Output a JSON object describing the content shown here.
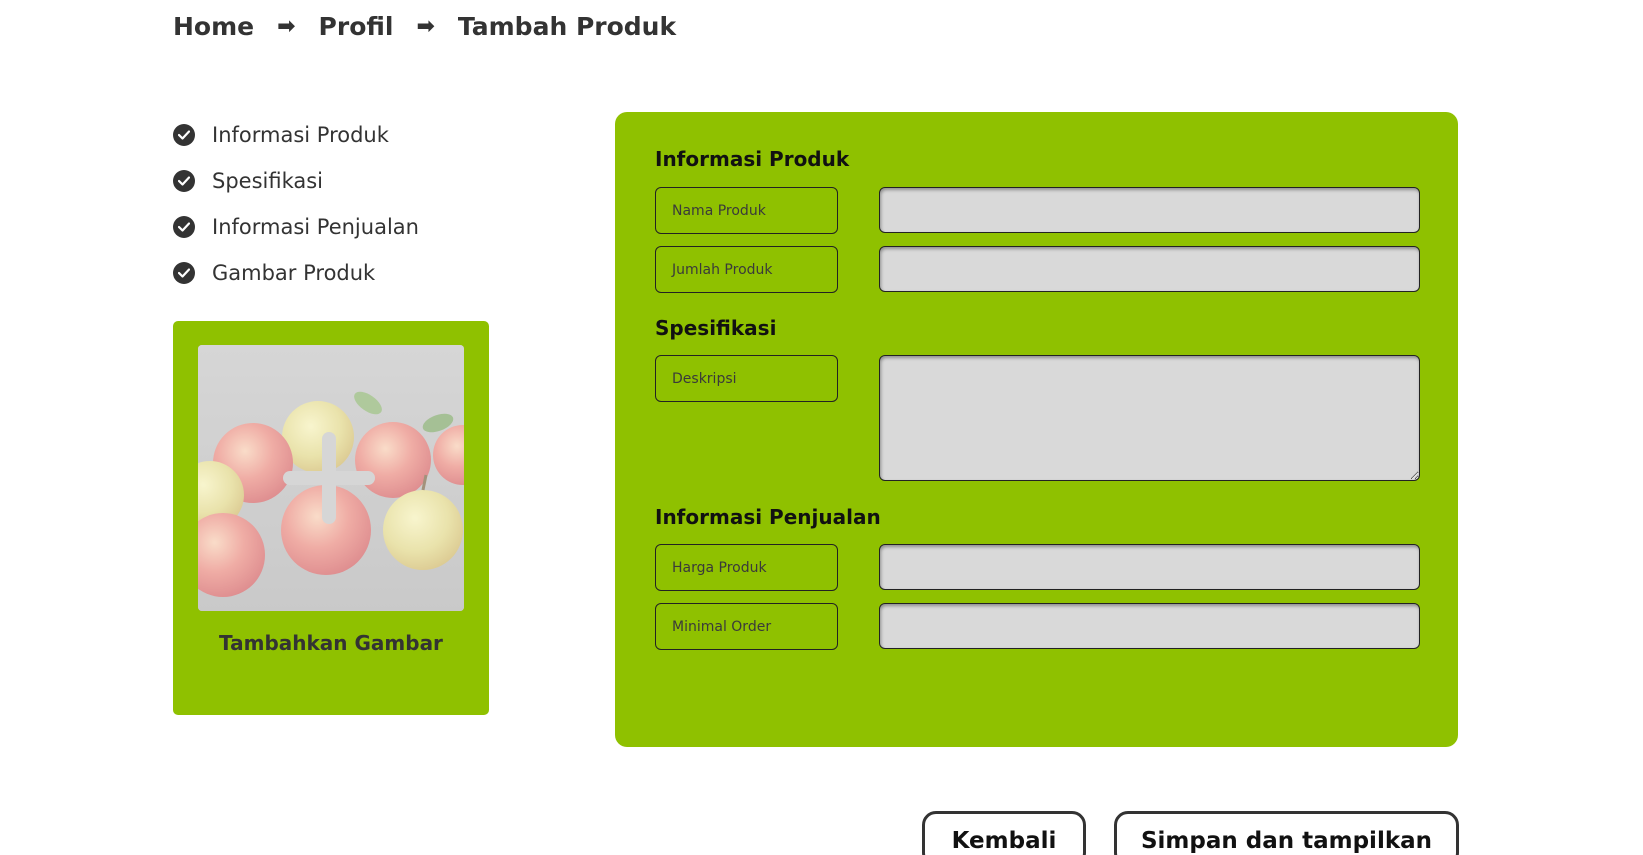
{
  "breadcrumb": {
    "items": [
      "Home",
      "Profil",
      "Tambah Produk"
    ],
    "separator": "➡"
  },
  "steps": [
    {
      "label": "Informasi Produk",
      "icon": "check-circle-icon"
    },
    {
      "label": "Spesifikasi",
      "icon": "check-circle-icon"
    },
    {
      "label": "Informasi Penjualan",
      "icon": "check-circle-icon"
    },
    {
      "label": "Gambar Produk",
      "icon": "check-circle-icon"
    }
  ],
  "image_card": {
    "caption": "Tambahkan Gambar",
    "icon": "plus-icon"
  },
  "form": {
    "sections": {
      "info_produk": "Informasi Produk",
      "spesifikasi": "Spesifikasi",
      "penjualan": "Informasi Penjualan"
    },
    "fields": {
      "nama_produk": {
        "label": "Nama Produk",
        "value": ""
      },
      "jumlah_produk": {
        "label": "Jumlah Produk",
        "value": ""
      },
      "deskripsi": {
        "label": "Deskripsi",
        "value": ""
      },
      "harga_produk": {
        "label": "Harga Produk",
        "value": ""
      },
      "minimal_order": {
        "label": "Minimal Order",
        "value": ""
      }
    }
  },
  "buttons": {
    "back": "Kembali",
    "save": "Simpan dan tampilkan"
  },
  "colors": {
    "accent_green": "#8fc100",
    "input_gray": "#d9d9d9",
    "text_dark": "#333333"
  }
}
